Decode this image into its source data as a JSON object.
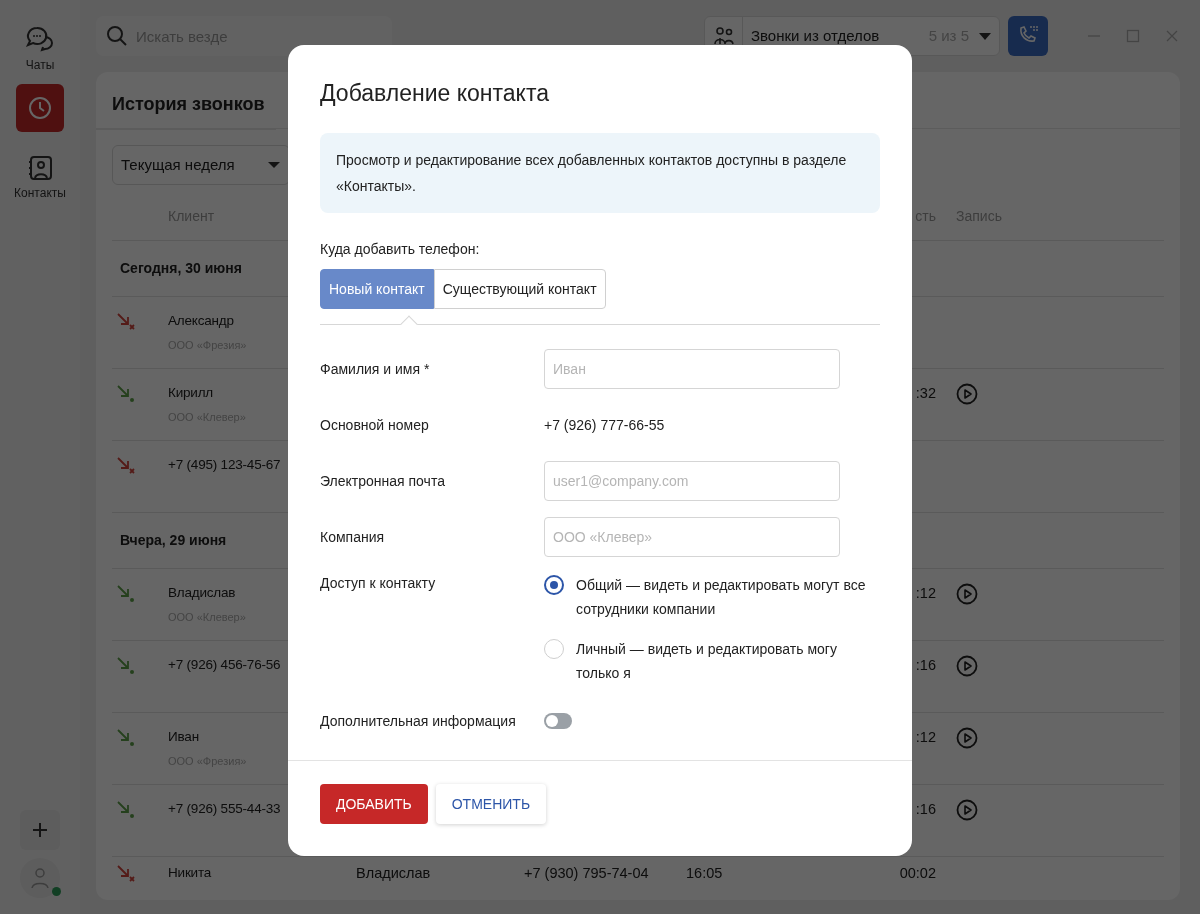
{
  "sidebar": {
    "items": [
      {
        "kind": "chats",
        "label": "Чаты",
        "selected": false
      },
      {
        "kind": "history",
        "selected": true
      },
      {
        "kind": "contacts",
        "label": "Контакты",
        "selected": false
      }
    ],
    "user": {
      "online": true
    }
  },
  "search": {
    "placeholder": "Искать везде"
  },
  "department_filter": {
    "label": "Звонки из отделов",
    "count": "5 из 5"
  },
  "call_history": {
    "title": "История звонков",
    "period": "Текущая неделя",
    "columns": [
      {
        "kind": "client",
        "label": "Клиент"
      },
      {
        "kind": "duration",
        "label": "сть"
      },
      {
        "kind": "record",
        "label": "Запись"
      }
    ],
    "groups": [
      {
        "title": "Сегодня, 30 июня",
        "calls": [
          {
            "missed": true,
            "client": "Александр",
            "company": "ООО «Фрезия»",
            "recording": false
          },
          {
            "missed": false,
            "client": "Кирилл",
            "company": "ООО «Клевер»",
            "duration": ":32",
            "recording": true
          },
          {
            "missed": true,
            "client": "+7 (495) 123-45-67",
            "recording": false
          }
        ]
      },
      {
        "title": "Вчера, 29 июня",
        "calls": [
          {
            "missed": false,
            "client": "Владислав",
            "company": "ООО «Клевер»",
            "duration": ":12",
            "recording": true
          },
          {
            "missed": false,
            "client": "+7 (926) 456-76-56",
            "duration": ":16",
            "recording": true
          },
          {
            "missed": false,
            "client": "Иван",
            "company": "ООО «Фрезия»",
            "duration": ":12",
            "recording": true
          },
          {
            "missed": false,
            "client": "+7 (926) 555-44-33",
            "duration": ":16",
            "recording": true
          },
          {
            "missed": true,
            "client": "Никита",
            "employee": "Владислав",
            "phone": "+7 (930) 795-74-04",
            "time": "16:05",
            "duration": "00:02",
            "recording": false
          }
        ]
      }
    ]
  },
  "modal": {
    "title": "Добавление контакта",
    "notice": "Просмотр и редактирование всех добавленных контактов доступны в разделе «Контакты».",
    "target_label": "Куда добавить телефон:",
    "target_options": [
      {
        "label": "Новый контакт",
        "selected": true
      },
      {
        "label": "Существующий контакт",
        "selected": false
      }
    ],
    "fields": [
      {
        "kind": "input",
        "label": "Фамилия и имя *",
        "placeholder": "Иван"
      },
      {
        "kind": "text",
        "label": "Основной номер",
        "value": "+7 (926) 777-66-55"
      },
      {
        "kind": "input",
        "label": "Электронная почта",
        "placeholder": "user1@company.com"
      },
      {
        "kind": "input",
        "label": "Компания",
        "placeholder": "ООО «Клевер»"
      },
      {
        "kind": "radio",
        "label": "Доступ к контакту",
        "options": [
          {
            "label": "Общий — видеть и редактировать могут все сотрудники компании",
            "selected": true
          },
          {
            "label": "Личный — видеть и редактировать могу только я",
            "selected": false
          }
        ]
      },
      {
        "kind": "toggle",
        "label": "Дополнительная информация",
        "on": false
      }
    ],
    "buttons": [
      {
        "kind": "primary",
        "label": "ДОБАВИТЬ"
      },
      {
        "kind": "secondary",
        "label": "ОТМЕНИТЬ"
      }
    ]
  }
}
